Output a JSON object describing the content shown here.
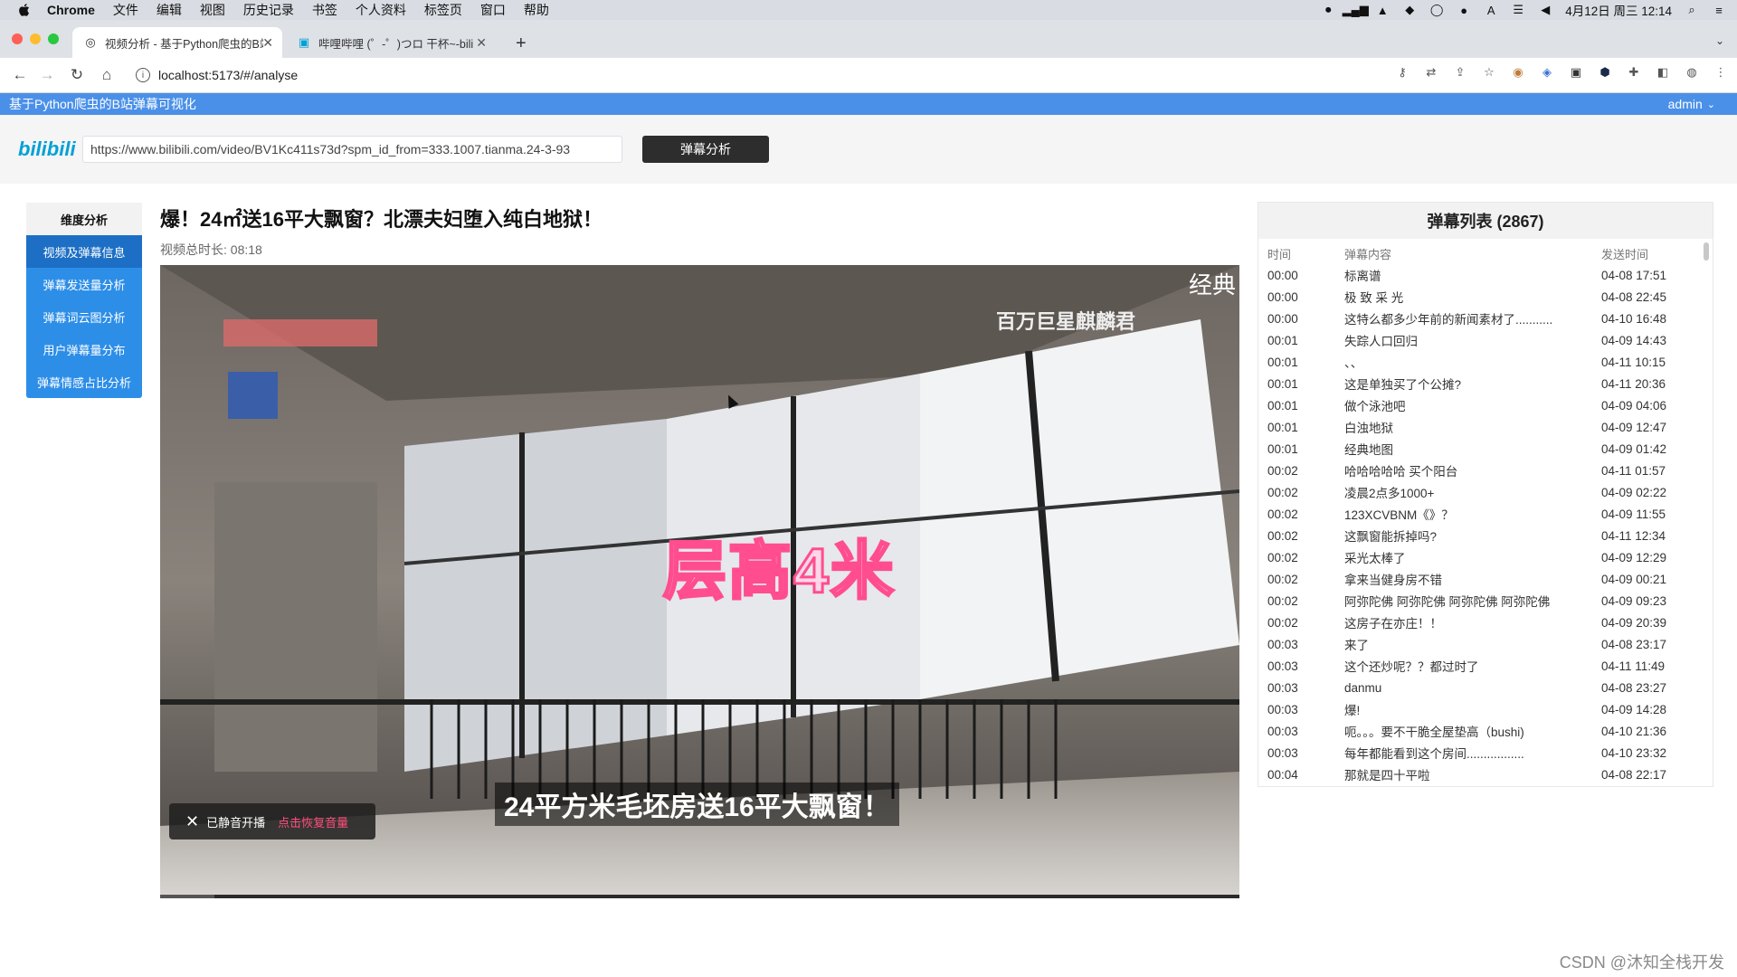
{
  "menubar": {
    "app": "Chrome",
    "items": [
      "文件",
      "编辑",
      "视图",
      "历史记录",
      "书签",
      "个人资料",
      "标签页",
      "窗口",
      "帮助"
    ],
    "clock": "4月12日 周三 12:14"
  },
  "tabs": [
    {
      "title": "视频分析 - 基于Python爬虫的B站",
      "active": true
    },
    {
      "title": "哔哩哔哩 (゜-゜)つロ 干杯~-bili",
      "active": false
    }
  ],
  "address": {
    "url": "localhost:5173/#/analyse"
  },
  "app": {
    "title": "基于Python爬虫的B站弹幕可视化",
    "user": "admin"
  },
  "search": {
    "logo": "bilibili",
    "value": "https://www.bilibili.com/video/BV1Kc411s73d?spm_id_from=333.1007.tianma.24-3-93",
    "button": "弹幕分析"
  },
  "sidebar": {
    "heading": "维度分析",
    "items": [
      "视频及弹幕信息",
      "弹幕发送量分析",
      "弹幕词云图分析",
      "用户弹幕量分布",
      "弹幕情感占比分析"
    ]
  },
  "video": {
    "title": "爆！24㎡送16平大飘窗？北漂夫妇堕入纯白地狱！",
    "duration_label": "视频总时长: 08:18",
    "corner_badge": "经典",
    "uploader_mark": "百万巨星麒麟君",
    "big_caption": "层高4米",
    "subtitle": "24平方米毛坯房送16平大飘窗！",
    "mute_text": "已静音开播",
    "restore_text": "点击恢复音量"
  },
  "danmaku": {
    "title": "弹幕列表 (2867)",
    "columns": [
      "时间",
      "弹幕内容",
      "发送时间"
    ],
    "rows": [
      [
        "00:00",
        "标离谱",
        "04-08 17:51"
      ],
      [
        "00:00",
        "极 致 采 光",
        "04-08 22:45"
      ],
      [
        "00:00",
        "这特么都多少年前的新闻素材了...........",
        "04-10 16:48"
      ],
      [
        "00:01",
        "失踪人口回归",
        "04-09 14:43"
      ],
      [
        "00:01",
        "、、",
        "04-11 10:15"
      ],
      [
        "00:01",
        "这是单独买了个公摊?",
        "04-11 20:36"
      ],
      [
        "00:01",
        "做个泳池吧",
        "04-09 04:06"
      ],
      [
        "00:01",
        "白浊地狱",
        "04-09 12:47"
      ],
      [
        "00:01",
        "经典地图",
        "04-09 01:42"
      ],
      [
        "00:02",
        "哈哈哈哈哈 买个阳台",
        "04-11 01:57"
      ],
      [
        "00:02",
        "凌晨2点多1000+",
        "04-09 02:22"
      ],
      [
        "00:02",
        "123XCVBNM《》？",
        "04-09 11:55"
      ],
      [
        "00:02",
        "这飘窗能拆掉吗?",
        "04-11 12:34"
      ],
      [
        "00:02",
        "采光太棒了",
        "04-09 12:29"
      ],
      [
        "00:02",
        "拿来当健身房不错",
        "04-09 00:21"
      ],
      [
        "00:02",
        "阿弥陀佛 阿弥陀佛 阿弥陀佛 阿弥陀佛",
        "04-09 09:23"
      ],
      [
        "00:02",
        "这房子在亦庄！！",
        "04-09 20:39"
      ],
      [
        "00:03",
        "来了",
        "04-08 23:17"
      ],
      [
        "00:03",
        "这个还炒呢？？都过时了",
        "04-11 11:49"
      ],
      [
        "00:03",
        "danmu",
        "04-08 23:27"
      ],
      [
        "00:03",
        "爆!",
        "04-09 14:28"
      ],
      [
        "00:03",
        "呃。。。要不干脆全屋垫高（bushi)",
        "04-10 21:36"
      ],
      [
        "00:03",
        "每年都能看到这个房间.................",
        "04-10 23:32"
      ],
      [
        "00:04",
        "那就是四十平啦",
        "04-08 22:17"
      ]
    ]
  },
  "watermark_footer": "CSDN @沐知全栈开发"
}
